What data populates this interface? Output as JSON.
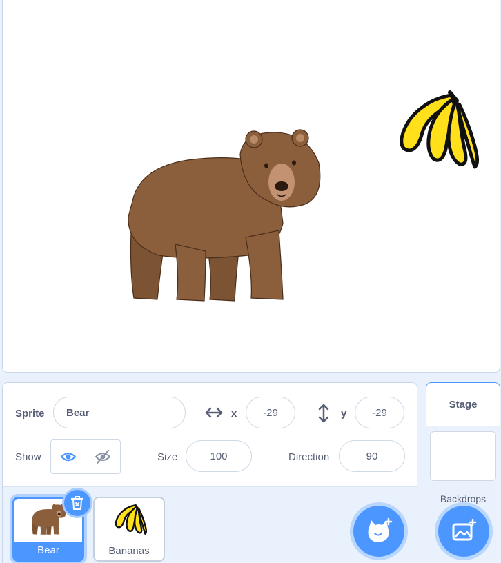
{
  "stage": {
    "sprites": [
      {
        "name": "bear-costume-icon"
      },
      {
        "name": "bananas-costume-icon"
      }
    ]
  },
  "sprite_info": {
    "sprite_label": "Sprite",
    "sprite_name": "Bear",
    "x_label": "x",
    "x_value": "-29",
    "y_label": "y",
    "y_value": "-29",
    "show_label": "Show",
    "size_label": "Size",
    "size_value": "100",
    "direction_label": "Direction",
    "direction_value": "90",
    "visible": true
  },
  "sprite_list": {
    "items": [
      {
        "label": "Bear",
        "selected": true
      },
      {
        "label": "Bananas",
        "selected": false
      }
    ]
  },
  "stage_target": {
    "title": "Stage",
    "backdrops_label": "Backdrops"
  },
  "colors": {
    "accent": "#4c97ff",
    "text": "#575e75",
    "pane_bg": "#e9f1fc",
    "bear_fur": "#8b5e3c",
    "banana": "#ffe01b"
  }
}
